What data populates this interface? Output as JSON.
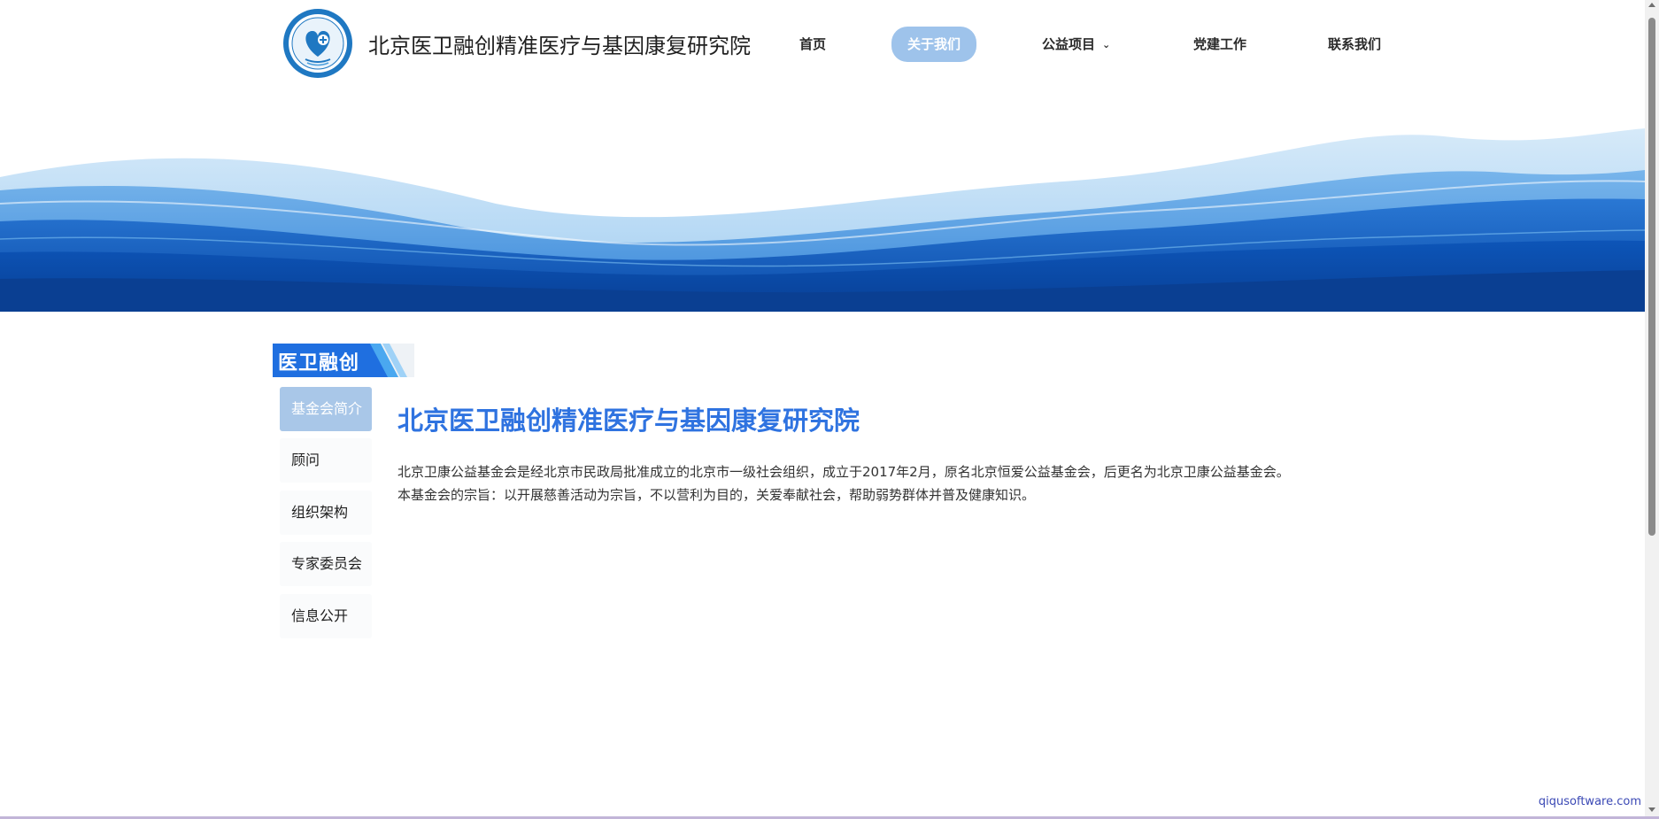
{
  "header": {
    "title": "北京医卫融创精准医疗与基因康复研究院",
    "logo_icon": "circular-seal-logo"
  },
  "nav": {
    "items": [
      {
        "label": "首页",
        "active": false
      },
      {
        "label": "关于我们",
        "active": true
      },
      {
        "label": "公益项目",
        "active": false,
        "has_dropdown": true
      },
      {
        "label": "党建工作",
        "active": false
      },
      {
        "label": "联系我们",
        "active": false
      }
    ]
  },
  "sidebar": {
    "title": "医卫融创",
    "items": [
      {
        "label": "基金会简介",
        "active": true
      },
      {
        "label": "顾问",
        "active": false
      },
      {
        "label": "组织架构",
        "active": false
      },
      {
        "label": "专家委员会",
        "active": false
      },
      {
        "label": "信息公开",
        "active": false
      }
    ]
  },
  "content": {
    "title": "北京医卫融创精准医疗与基因康复研究院",
    "paragraphs": [
      "北京卫康公益基金会是经北京市民政局批准成立的北京市一级社会组织，成立于2017年2月，原名北京恒爱公益基金会，后更名为北京卫康公益基金会。",
      "本基金会的宗旨：以开展慈善活动为宗旨，不以营利为目的，关爱奉献社会，帮助弱势群体并普及健康知识。"
    ]
  },
  "watermark": "qiqusoftware.com",
  "colors": {
    "accent": "#2f73e0",
    "nav_active_bg": "#9ec3eb",
    "side_active_bg": "#a9c7e8",
    "wave_dark": "#0b4fb0",
    "wave_light": "#8fc4ef"
  }
}
